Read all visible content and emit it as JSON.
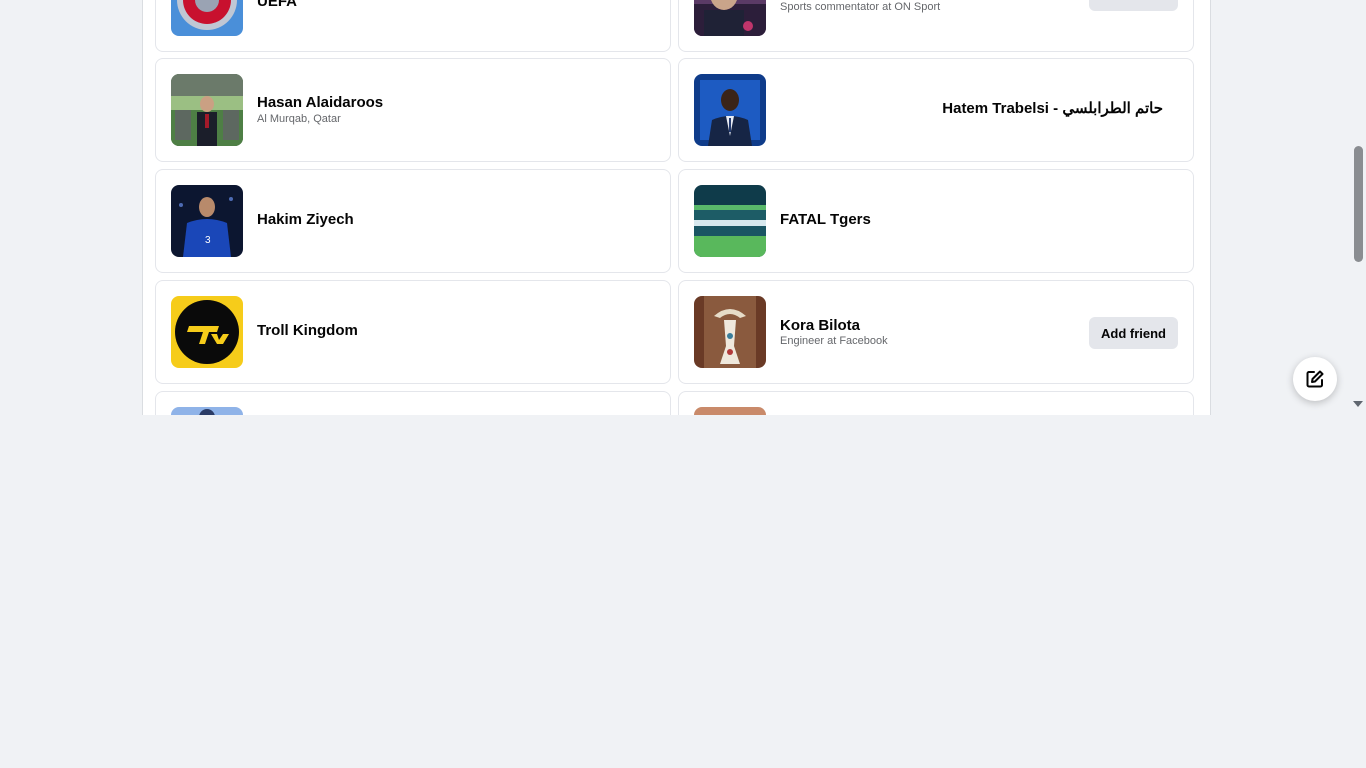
{
  "add_friend_label": "Add friend",
  "cards": [
    {
      "name": "UEFA",
      "subtitle": ""
    },
    {
      "name": "",
      "subtitle": "Sports commentator at ON Sport"
    },
    {
      "name": "Hasan Alaidaroos",
      "subtitle": "Al Murqab, Qatar"
    },
    {
      "name": "Hatem Trabelsi - حاتم الطرابلسي",
      "subtitle": ""
    },
    {
      "name": "Hakim Ziyech",
      "subtitle": ""
    },
    {
      "name": "FATAL Tgers",
      "subtitle": ""
    },
    {
      "name": "Troll Kingdom",
      "subtitle": ""
    },
    {
      "name": "Kora Bilota",
      "subtitle": "Engineer at Facebook"
    }
  ],
  "icons": {
    "fab": "compose-icon",
    "scroll_down": "scroll-down-arrow-icon"
  },
  "colors": {
    "page_bg": "#f0f2f5",
    "card_border": "#e4e6eb",
    "button_bg": "#e4e6eb",
    "text_primary": "#050505",
    "text_secondary": "#65676b"
  }
}
